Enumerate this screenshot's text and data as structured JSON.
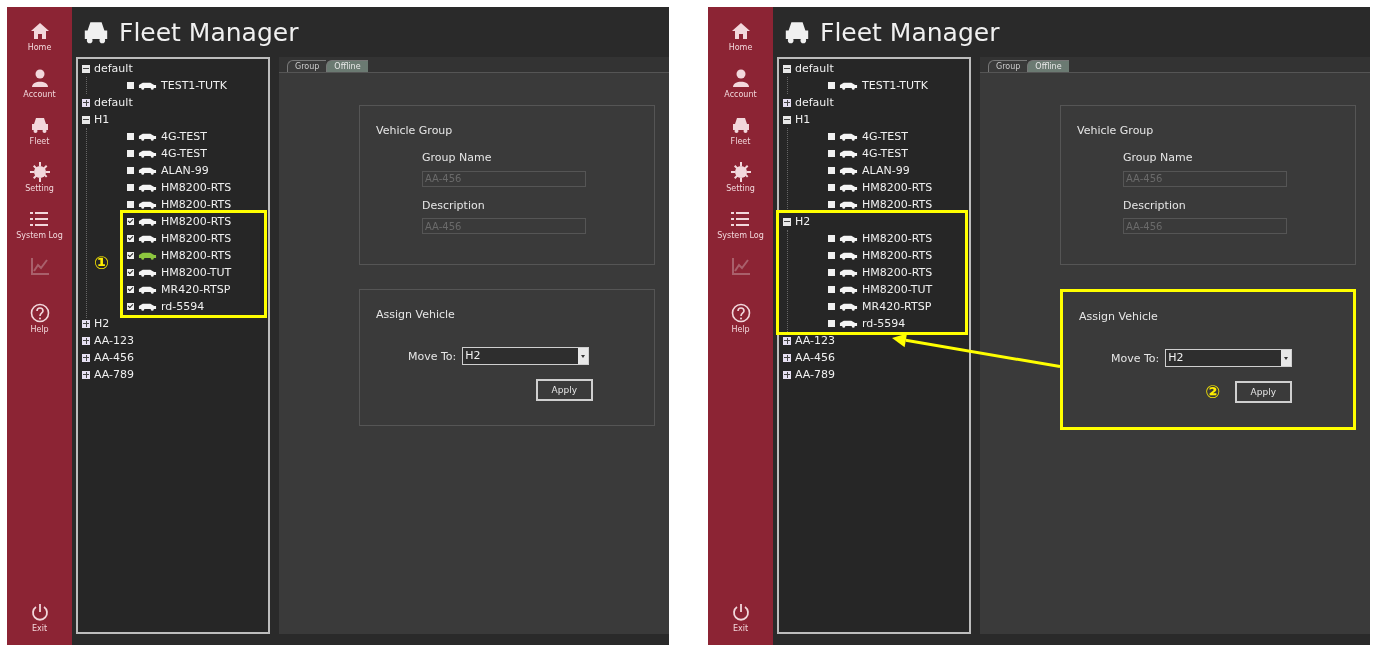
{
  "screens": [
    {
      "sidebar": [
        {
          "label": "Home",
          "disabled": false
        },
        {
          "label": "Account",
          "disabled": false
        },
        {
          "label": "Fleet",
          "disabled": false
        },
        {
          "label": "Setting",
          "disabled": false
        },
        {
          "label": "System Log",
          "disabled": false
        },
        {
          "disabled": true
        },
        {
          "label": "Help",
          "disabled": false
        }
      ],
      "exit": {
        "label": "Exit"
      },
      "title": "Fleet Manager",
      "tree": [
        {
          "kind": "group",
          "label": "default",
          "expanded": true,
          "children": [
            {
              "kind": "vehicle",
              "label": "TEST1-TUTK",
              "checked": false,
              "active": false
            }
          ]
        },
        {
          "kind": "group",
          "label": "default",
          "expanded": false
        },
        {
          "kind": "group",
          "label": "H1",
          "expanded": true,
          "children": [
            {
              "kind": "vehicle",
              "label": "4G-TEST",
              "checked": false,
              "active": false
            },
            {
              "kind": "vehicle",
              "label": "4G-TEST",
              "checked": false,
              "active": false
            },
            {
              "kind": "vehicle",
              "label": "ALAN-99",
              "checked": false,
              "active": false
            },
            {
              "kind": "vehicle",
              "label": "HM8200-RTS",
              "checked": false,
              "active": false
            },
            {
              "kind": "vehicle",
              "label": "HM8200-RTS",
              "checked": false,
              "active": false
            },
            {
              "kind": "callout",
              "marker": "①",
              "children": [
                {
                  "kind": "vehicle",
                  "label": "HM8200-RTS",
                  "checked": true,
                  "active": false
                },
                {
                  "kind": "vehicle",
                  "label": "HM8200-RTS",
                  "checked": true,
                  "active": false
                },
                {
                  "kind": "vehicle",
                  "label": "HM8200-RTS",
                  "checked": true,
                  "active": true
                },
                {
                  "kind": "vehicle",
                  "label": "HM8200-TUT",
                  "checked": true,
                  "active": false
                },
                {
                  "kind": "vehicle",
                  "label": "MR420-RTSP",
                  "checked": true,
                  "active": false
                },
                {
                  "kind": "vehicle",
                  "label": "rd-5594",
                  "checked": true,
                  "active": false
                }
              ]
            }
          ]
        },
        {
          "kind": "group",
          "label": "H2",
          "expanded": false
        },
        {
          "kind": "group",
          "label": "AA-123",
          "expanded": false
        },
        {
          "kind": "group",
          "label": "AA-456",
          "expanded": false
        },
        {
          "kind": "group",
          "label": "AA-789",
          "expanded": false
        }
      ],
      "arrow": false,
      "tabs": [
        {
          "label": "Group",
          "selected": true
        },
        {
          "label": "Offline",
          "selected": false
        }
      ],
      "vehicle_group": {
        "heading": "Vehicle Group",
        "fields": [
          {
            "label": "Group Name",
            "value": "AA-456"
          },
          {
            "label": "Description",
            "value": "AA-456"
          }
        ]
      },
      "assign": {
        "heading": "Assign Vehicle",
        "label": "Move To:",
        "value": "H2",
        "button": "Apply",
        "highlighted": false
      }
    },
    {
      "sidebar": [
        {
          "label": "Home",
          "disabled": false
        },
        {
          "label": "Account",
          "disabled": false
        },
        {
          "label": "Fleet",
          "disabled": false
        },
        {
          "label": "Setting",
          "disabled": false
        },
        {
          "label": "System Log",
          "disabled": false
        },
        {
          "disabled": true
        },
        {
          "label": "Help",
          "disabled": false
        }
      ],
      "exit": {
        "label": "Exit"
      },
      "title": "Fleet Manager",
      "tree": [
        {
          "kind": "group",
          "label": "default",
          "expanded": true,
          "children": [
            {
              "kind": "vehicle",
              "label": "TEST1-TUTK",
              "checked": false,
              "active": false
            }
          ]
        },
        {
          "kind": "group",
          "label": "default",
          "expanded": false
        },
        {
          "kind": "group",
          "label": "H1",
          "expanded": true,
          "children": [
            {
              "kind": "vehicle",
              "label": "4G-TEST",
              "checked": false,
              "active": false
            },
            {
              "kind": "vehicle",
              "label": "4G-TEST",
              "checked": false,
              "active": false
            },
            {
              "kind": "vehicle",
              "label": "ALAN-99",
              "checked": false,
              "active": false
            },
            {
              "kind": "vehicle",
              "label": "HM8200-RTS",
              "checked": false,
              "active": false
            },
            {
              "kind": "vehicle",
              "label": "HM8200-RTS",
              "checked": false,
              "active": false
            }
          ]
        },
        {
          "kind": "callout",
          "children": [
            {
              "kind": "group",
              "label": "H2",
              "expanded": true,
              "children": [
                {
                  "kind": "vehicle",
                  "label": "HM8200-RTS",
                  "checked": false,
                  "active": false
                },
                {
                  "kind": "vehicle",
                  "label": "HM8200-RTS",
                  "checked": false,
                  "active": false
                },
                {
                  "kind": "vehicle",
                  "label": "HM8200-RTS",
                  "checked": false,
                  "active": false
                },
                {
                  "kind": "vehicle",
                  "label": "HM8200-TUT",
                  "checked": false,
                  "active": false
                },
                {
                  "kind": "vehicle",
                  "label": "MR420-RTSP",
                  "checked": false,
                  "active": false
                },
                {
                  "kind": "vehicle",
                  "label": "rd-5594",
                  "checked": false,
                  "active": false
                }
              ]
            }
          ]
        },
        {
          "kind": "group",
          "label": "AA-123",
          "expanded": false
        },
        {
          "kind": "group",
          "label": "AA-456",
          "expanded": false
        },
        {
          "kind": "group",
          "label": "AA-789",
          "expanded": false
        }
      ],
      "arrow": true,
      "tabs": [
        {
          "label": "Group",
          "selected": true
        },
        {
          "label": "Offline",
          "selected": false
        }
      ],
      "vehicle_group": {
        "heading": "Vehicle Group",
        "fields": [
          {
            "label": "Group Name",
            "value": "AA-456"
          },
          {
            "label": "Description",
            "value": "AA-456"
          }
        ]
      },
      "assign": {
        "heading": "Assign Vehicle",
        "label": "Move To:",
        "value": "H2",
        "button": "Apply",
        "highlighted": true,
        "marker": "②"
      }
    }
  ]
}
